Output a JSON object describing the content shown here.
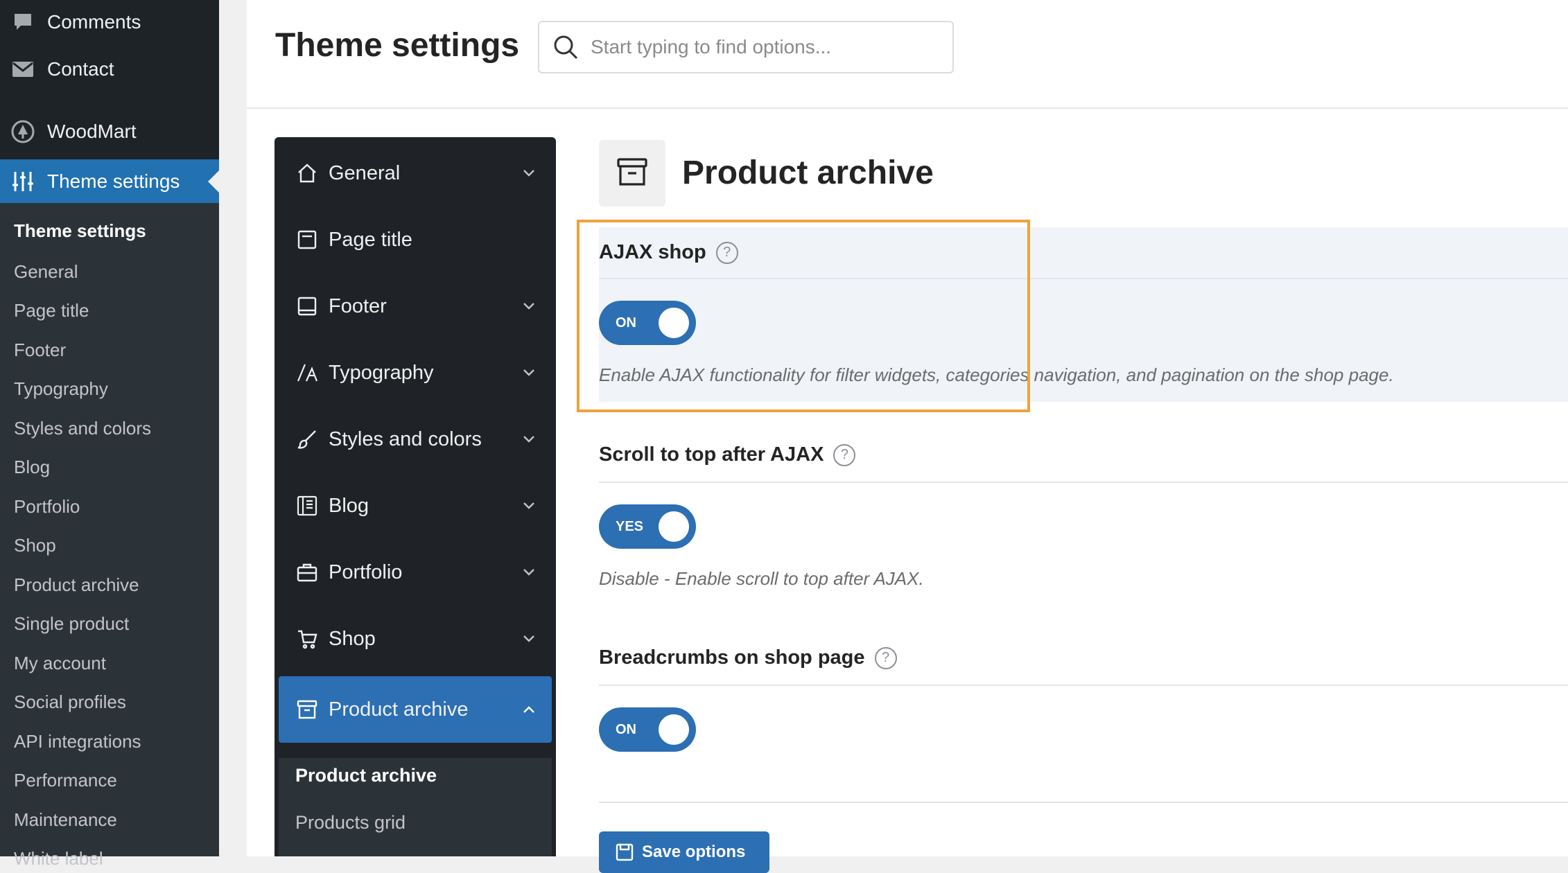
{
  "wp_menu": {
    "items": [
      {
        "label": "Comments",
        "icon": "comment-icon"
      },
      {
        "label": "Contact",
        "icon": "mail-icon"
      },
      {
        "label": "WoodMart",
        "icon": "woodmart-logo-icon"
      },
      {
        "label": "Theme settings",
        "icon": "sliders-icon",
        "active": true
      }
    ],
    "submenu": [
      "Theme settings",
      "General",
      "Page title",
      "Footer",
      "Typography",
      "Styles and colors",
      "Blog",
      "Portfolio",
      "Shop",
      "Product archive",
      "Single product",
      "My account",
      "Social profiles",
      "API integrations",
      "Performance",
      "Maintenance",
      "White label"
    ]
  },
  "header": {
    "title": "Theme settings",
    "search_placeholder": "Start typing to find options..."
  },
  "options_nav": {
    "items": [
      {
        "label": "General",
        "icon": "home-icon"
      },
      {
        "label": "Page title",
        "icon": "page-title-icon"
      },
      {
        "label": "Footer",
        "icon": "footer-icon"
      },
      {
        "label": "Typography",
        "icon": "typography-icon"
      },
      {
        "label": "Styles and colors",
        "icon": "brush-icon"
      },
      {
        "label": "Blog",
        "icon": "blog-icon"
      },
      {
        "label": "Portfolio",
        "icon": "briefcase-icon"
      },
      {
        "label": "Shop",
        "icon": "cart-icon"
      },
      {
        "label": "Product archive",
        "icon": "archive-icon",
        "active": true
      }
    ],
    "submenu": [
      "Product archive",
      "Products grid"
    ]
  },
  "section": {
    "title": "Product archive",
    "options": [
      {
        "title": "AJAX shop",
        "toggle": "ON",
        "description": "Enable AJAX functionality for filter widgets, categories navigation, and pagination on the shop page."
      },
      {
        "title": "Scroll to top after AJAX",
        "toggle": "YES",
        "description": "Disable - Enable scroll to top after AJAX."
      },
      {
        "title": "Breadcrumbs on shop page",
        "toggle": "ON",
        "description": ""
      }
    ],
    "save_label": "Save options"
  },
  "colors": {
    "wp_sidebar": "#1d2327",
    "accent_blue": "#2c6fb3",
    "highlight_orange": "#f0a23b"
  },
  "help_glyph": "?"
}
